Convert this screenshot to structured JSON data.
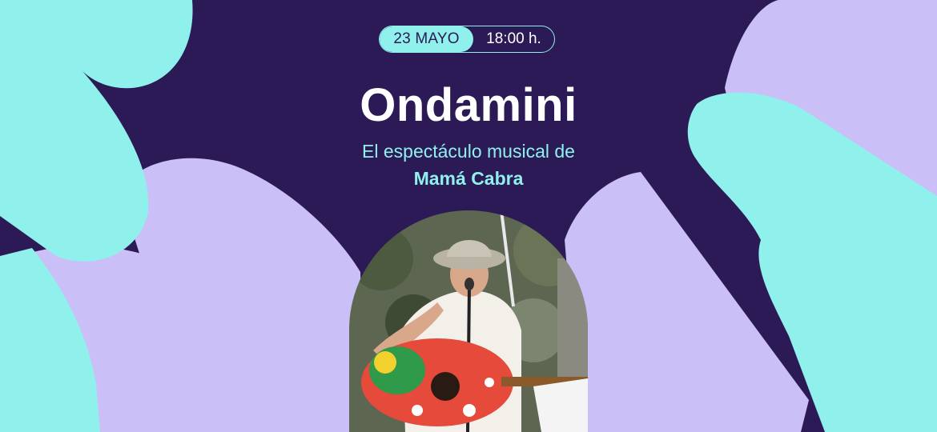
{
  "event": {
    "date": "23 MAYO",
    "time": "18:00 h.",
    "title": "Ondamini",
    "subtitle_line1": "El espectáculo musical de",
    "subtitle_line2": "Mamá Cabra"
  },
  "photo": {
    "subject": "performer-with-guitar-and-microphone"
  },
  "colors": {
    "background": "#2b1a55",
    "aqua": "#8ff0ec",
    "lavender": "#cbbff7",
    "white": "#ffffff"
  }
}
